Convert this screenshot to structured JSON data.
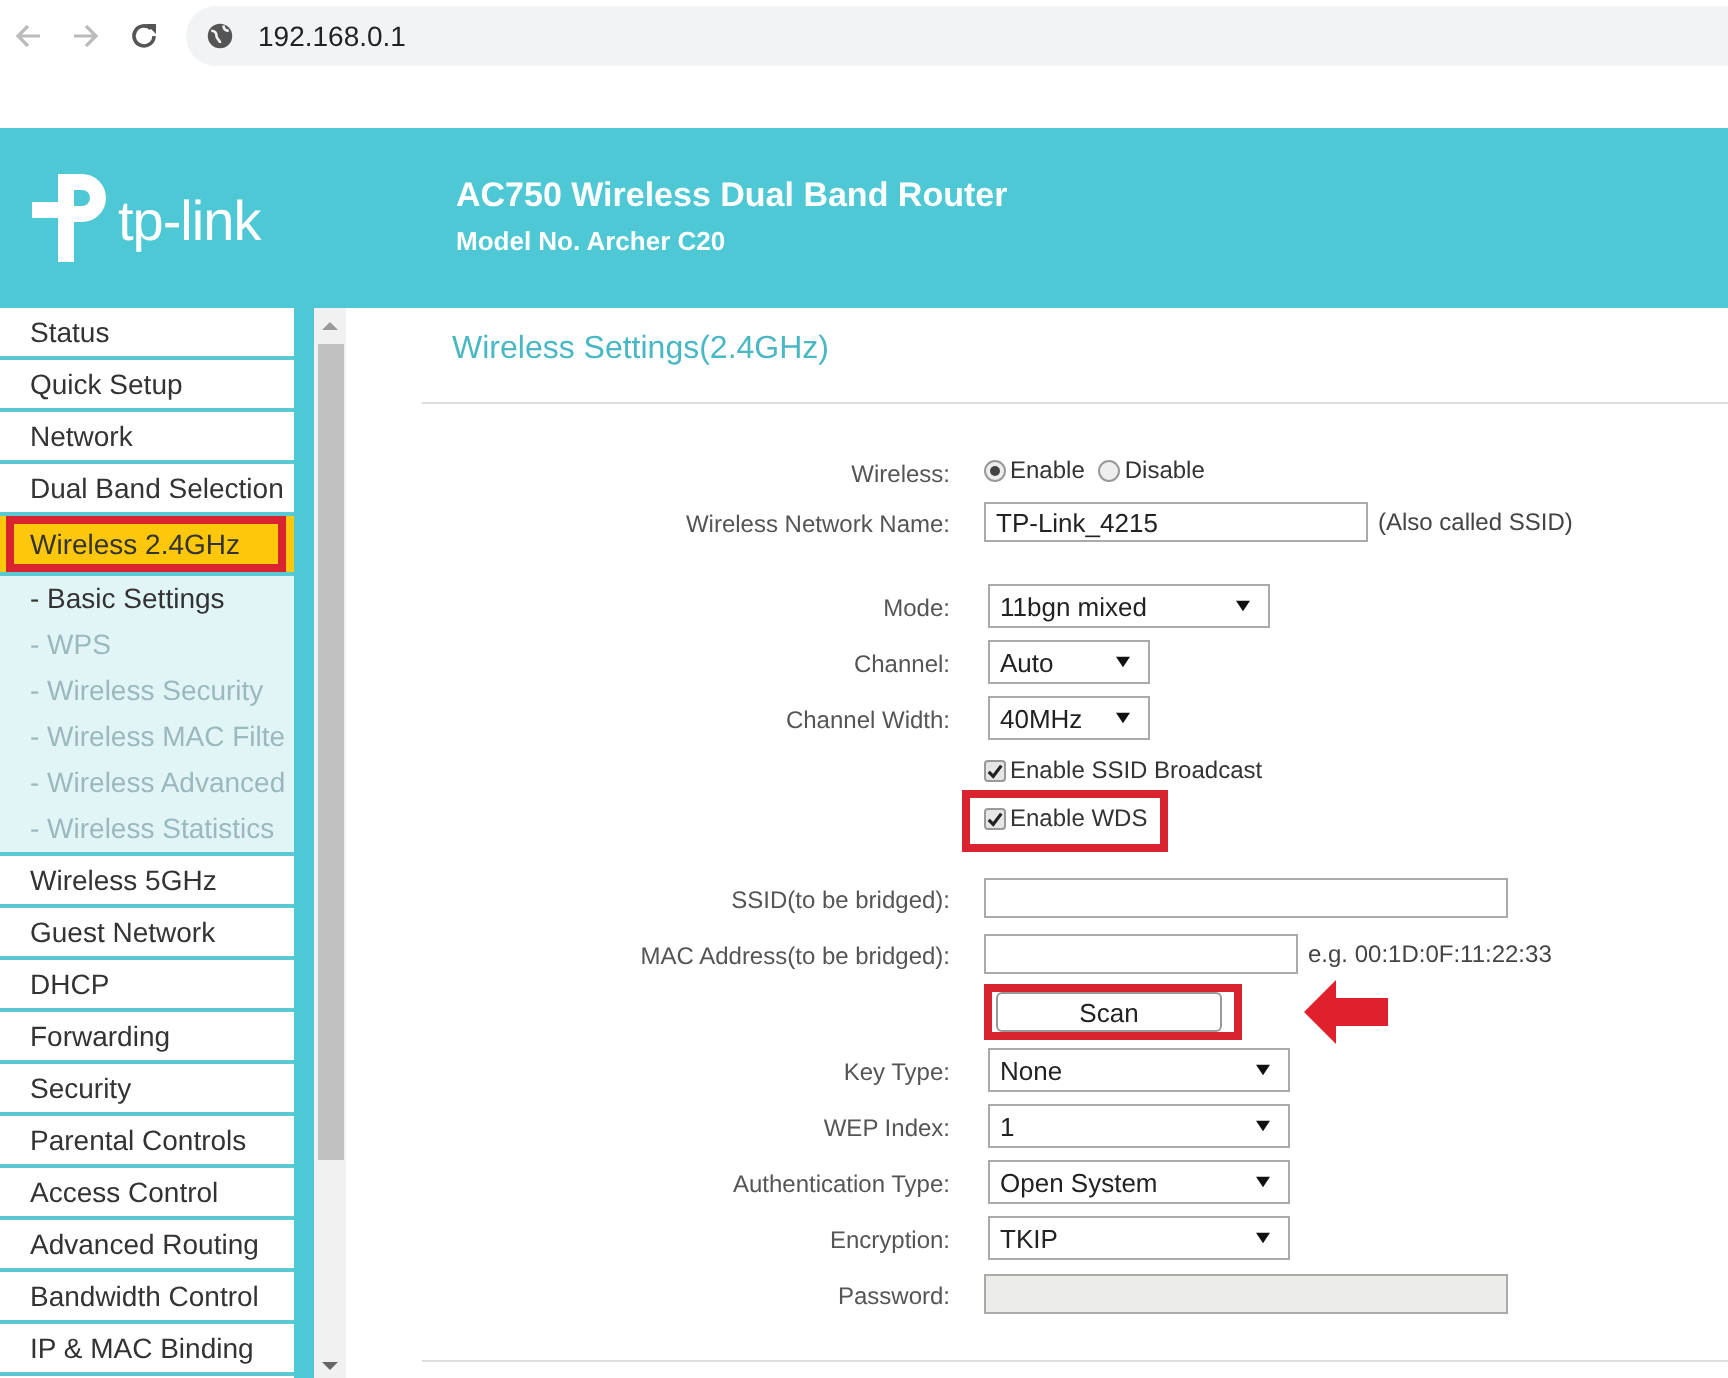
{
  "browser": {
    "url": "192.168.0.1"
  },
  "header": {
    "logo": "tp-link",
    "title": "AC750 Wireless Dual Band Router",
    "model": "Model No. Archer C20"
  },
  "sidebar": {
    "items": [
      {
        "label": "Status",
        "selected": false,
        "highlighted": false
      },
      {
        "label": "Quick Setup",
        "selected": false,
        "highlighted": false
      },
      {
        "label": "Network",
        "selected": false,
        "highlighted": false
      },
      {
        "label": "Dual Band Selection",
        "selected": false,
        "highlighted": false
      },
      {
        "label": "Wireless 2.4GHz",
        "selected": true,
        "highlighted": true,
        "children": [
          {
            "label": "- Basic Settings",
            "selected": true
          },
          {
            "label": "- WPS",
            "selected": false
          },
          {
            "label": "- Wireless Security",
            "selected": false
          },
          {
            "label": "- Wireless MAC Filte",
            "selected": false
          },
          {
            "label": "- Wireless Advanced",
            "selected": false
          },
          {
            "label": "- Wireless Statistics",
            "selected": false
          }
        ]
      },
      {
        "label": "Wireless 5GHz",
        "selected": false,
        "highlighted": false
      },
      {
        "label": "Guest Network",
        "selected": false,
        "highlighted": false
      },
      {
        "label": "DHCP",
        "selected": false,
        "highlighted": false
      },
      {
        "label": "Forwarding",
        "selected": false,
        "highlighted": false
      },
      {
        "label": "Security",
        "selected": false,
        "highlighted": false
      },
      {
        "label": "Parental Controls",
        "selected": false,
        "highlighted": false
      },
      {
        "label": "Access Control",
        "selected": false,
        "highlighted": false
      },
      {
        "label": "Advanced Routing",
        "selected": false,
        "highlighted": false
      },
      {
        "label": "Bandwidth Control",
        "selected": false,
        "highlighted": false
      },
      {
        "label": "IP & MAC Binding",
        "selected": false,
        "highlighted": false
      }
    ]
  },
  "page_title": "Wireless Settings(2.4GHz)",
  "form": {
    "sections": [
      [
        {
          "kind": "radio",
          "label": "Wireless:",
          "options": [
            {
              "label": "Enable",
              "selected": true
            },
            {
              "label": "Disable",
              "selected": false
            }
          ]
        },
        {
          "kind": "text",
          "label": "Wireless Network Name:",
          "value": "TP-Link_4215",
          "note": "(Also called SSID)"
        }
      ],
      [
        {
          "kind": "select",
          "label": "Mode:",
          "value": "11bgn mixed"
        },
        {
          "kind": "select",
          "label": "Channel:",
          "value": "Auto"
        },
        {
          "kind": "select",
          "label": "Channel Width:",
          "value": "40MHz"
        },
        {
          "kind": "checkbox",
          "text": "Enable SSID Broadcast",
          "checked": true,
          "highlighted": false
        },
        {
          "kind": "checkbox",
          "text": "Enable WDS",
          "checked": true,
          "highlighted": true
        }
      ],
      [
        {
          "kind": "text",
          "label": "SSID(to be bridged):"
        },
        {
          "kind": "text",
          "label": "MAC Address(to be bridged):",
          "note": "e.g. 00:1D:0F:11:22:33"
        },
        {
          "kind": "button",
          "text": "Scan",
          "highlighted": true,
          "arrow": true
        },
        {
          "kind": "select",
          "label": "Key Type:",
          "value": "None"
        },
        {
          "kind": "select",
          "label": "WEP Index:",
          "value": "1"
        },
        {
          "kind": "select",
          "label": "Authentication Type:",
          "value": "Open System"
        },
        {
          "kind": "select",
          "label": "Encryption:",
          "value": "TKIP"
        },
        {
          "kind": "text",
          "label": "Password:",
          "disabled": true
        }
      ]
    ]
  }
}
